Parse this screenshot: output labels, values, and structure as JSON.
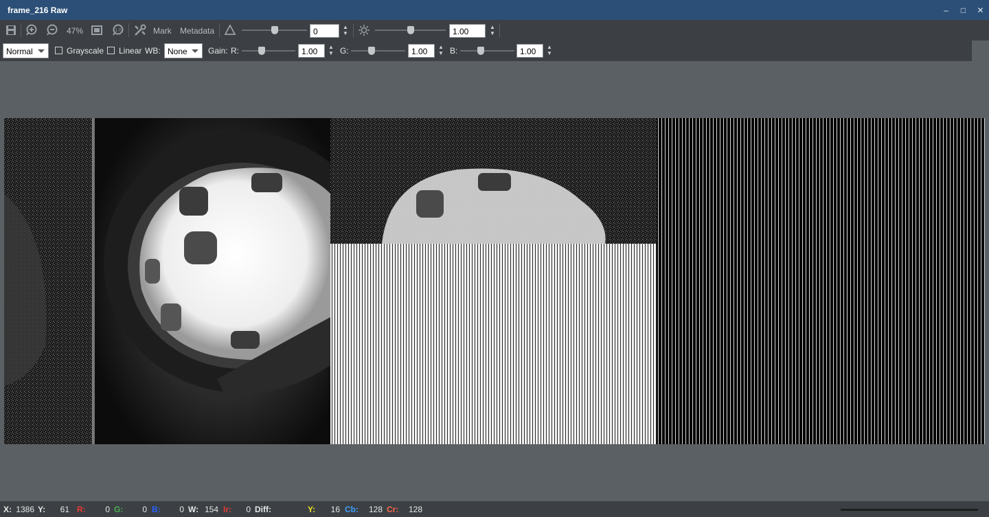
{
  "window": {
    "title": "frame_216 Raw",
    "minimize": "–",
    "maximize": "□",
    "close": "✕"
  },
  "toolbar1": {
    "zoom_label": "47%",
    "mark_label": "Mark",
    "metadata_label": "Metadata",
    "contrast_value": "0",
    "brightness_value": "1.00",
    "icons": [
      "save-icon",
      "zoom-in-icon",
      "zoom-out-icon",
      "fit-icon",
      "actual-size-icon",
      "tools-icon",
      "contrast-icon",
      "brightness-icon"
    ],
    "contrast_slider_level": 0.5,
    "brightness_slider_level": 0.5
  },
  "toolbar2": {
    "mode_select": "Normal",
    "grayscale_label": "Grayscale",
    "linear_label": "Linear",
    "wb_label": "WB:",
    "wb_select": "None",
    "gain_label": "Gain:",
    "r_label": "R:",
    "r_value": "1.00",
    "g_label": "G:",
    "g_value": "1.00",
    "b_label": "B:",
    "b_value": "1.00",
    "grayscale_checked": false,
    "linear_checked": false
  },
  "status": {
    "x_label": "X:",
    "x_value": "1386",
    "y_label": "Y:",
    "y_value": "61",
    "r_label": "R:",
    "r_value": "0",
    "g_label": "G:",
    "g_value": "0",
    "b_label": "B:",
    "b_value": "0",
    "w_label": "W:",
    "w_value": "154",
    "ir_label": "Ir:",
    "ir_value": "0",
    "diff_label": "Diff:",
    "yy_label": "Y:",
    "yy_value": "16",
    "cb_label": "Cb:",
    "cb_value": "128",
    "cr_label": "Cr:",
    "cr_value": "128"
  },
  "colors": {
    "titlebar": "#2b4f77",
    "toolbar": "#3c4044",
    "canvas": "#5b6064",
    "r": "#e53935",
    "g": "#4caf50",
    "b": "#2962ff",
    "y": "#f0e020",
    "cb": "#3ea0ff",
    "cr": "#ff6a4a"
  }
}
